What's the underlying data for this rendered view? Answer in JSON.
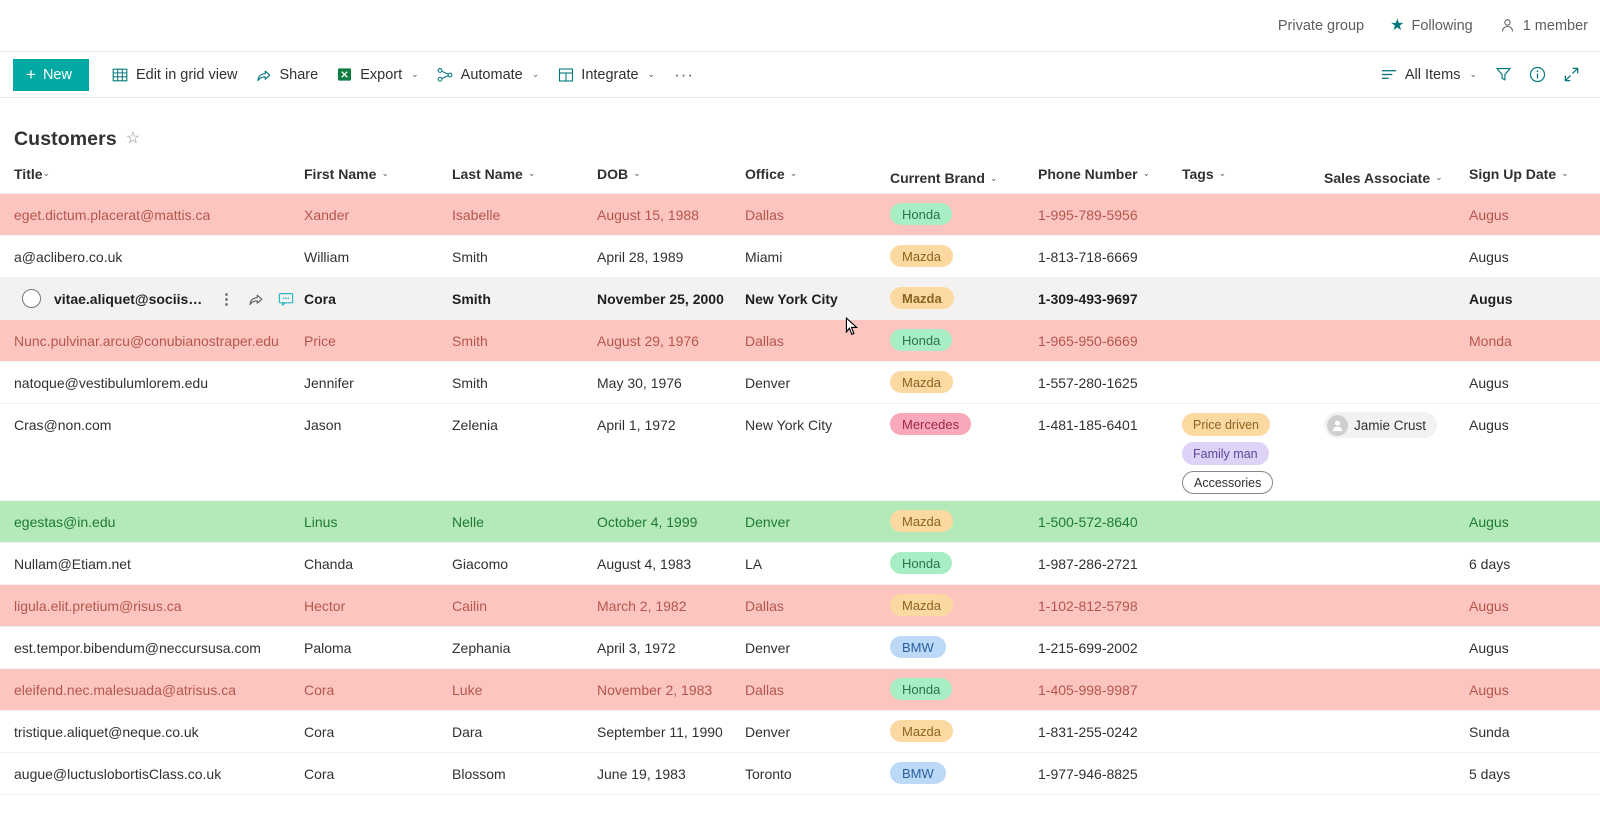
{
  "site_header": {
    "privacy_label": "Private group",
    "following_label": "Following",
    "members_label": "1 member",
    "star_glyph": "★"
  },
  "command_bar": {
    "new_label": "New",
    "new_plus": "+",
    "new_color": "#03a9a3",
    "items": [
      {
        "label": "Edit in grid view",
        "icon": "grid-icon",
        "has_chevron": false
      },
      {
        "label": "Share",
        "icon": "share-icon",
        "has_chevron": false
      },
      {
        "label": "Export",
        "icon": "excel-icon",
        "has_chevron": true
      },
      {
        "label": "Automate",
        "icon": "automate-icon",
        "has_chevron": true
      },
      {
        "label": "Integrate",
        "icon": "integrate-icon",
        "has_chevron": true
      }
    ],
    "overflow_label": "···",
    "view_label": "All Items",
    "chevron_glyph": "⌄"
  },
  "page": {
    "title": "Customers",
    "favorite_glyph": "☆"
  },
  "table": {
    "columns": [
      {
        "label": "Title",
        "key": "title"
      },
      {
        "label": "First Name",
        "key": "first"
      },
      {
        "label": "Last Name",
        "key": "last"
      },
      {
        "label": "DOB",
        "key": "dob"
      },
      {
        "label": "Office",
        "key": "office"
      },
      {
        "label": "Current Brand",
        "key": "brand"
      },
      {
        "label": "Phone Number",
        "key": "phone"
      },
      {
        "label": "Tags",
        "key": "tags"
      },
      {
        "label": "Sales Associate",
        "key": "assoc"
      },
      {
        "label": "Sign Up Date",
        "key": "sign"
      }
    ],
    "rows": [
      {
        "state": "red",
        "title": "eget.dictum.placerat@mattis.ca",
        "first": "Xander",
        "last": "Isabelle",
        "dob": "August 15, 1988",
        "office": "Dallas",
        "brand": "Honda",
        "phone": "1-995-789-5956",
        "tags": [],
        "assoc": "",
        "sign": "Augus"
      },
      {
        "state": "plain",
        "title": "a@aclibero.co.uk",
        "first": "William",
        "last": "Smith",
        "dob": "April 28, 1989",
        "office": "Miami",
        "brand": "Mazda",
        "phone": "1-813-718-6669",
        "tags": [],
        "assoc": "",
        "sign": "Augus"
      },
      {
        "state": "hovered",
        "title": "vitae.aliquet@sociisnatoq...",
        "first": "Cora",
        "last": "Smith",
        "dob": "November 25, 2000",
        "office": "New York City",
        "brand": "Mazda",
        "phone": "1-309-493-9697",
        "tags": [],
        "assoc": "",
        "sign": "Augus"
      },
      {
        "state": "red",
        "title": "Nunc.pulvinar.arcu@conubianostraper.edu",
        "first": "Price",
        "last": "Smith",
        "dob": "August 29, 1976",
        "office": "Dallas",
        "brand": "Honda",
        "phone": "1-965-950-6669",
        "tags": [],
        "assoc": "",
        "sign": "Monda"
      },
      {
        "state": "plain",
        "title": "natoque@vestibulumlorem.edu",
        "first": "Jennifer",
        "last": "Smith",
        "dob": "May 30, 1976",
        "office": "Denver",
        "brand": "Mazda",
        "phone": "1-557-280-1625",
        "tags": [],
        "assoc": "",
        "sign": "Augus"
      },
      {
        "state": "plain",
        "tall": true,
        "title": "Cras@non.com",
        "first": "Jason",
        "last": "Zelenia",
        "dob": "April 1, 1972",
        "office": "New York City",
        "brand": "Mercedes",
        "phone": "1-481-185-6401",
        "tags": [
          "Price driven",
          "Family man",
          "Accessories"
        ],
        "assoc": "Jamie Crust",
        "sign": "Augus"
      },
      {
        "state": "green",
        "title": "egestas@in.edu",
        "first": "Linus",
        "last": "Nelle",
        "dob": "October 4, 1999",
        "office": "Denver",
        "brand": "Mazda",
        "phone": "1-500-572-8640",
        "tags": [],
        "assoc": "",
        "sign": "Augus"
      },
      {
        "state": "plain",
        "title": "Nullam@Etiam.net",
        "first": "Chanda",
        "last": "Giacomo",
        "dob": "August 4, 1983",
        "office": "LA",
        "brand": "Honda",
        "phone": "1-987-286-2721",
        "tags": [],
        "assoc": "",
        "sign": "6 days"
      },
      {
        "state": "red",
        "title": "ligula.elit.pretium@risus.ca",
        "first": "Hector",
        "last": "Cailin",
        "dob": "March 2, 1982",
        "office": "Dallas",
        "brand": "Mazda",
        "phone": "1-102-812-5798",
        "tags": [],
        "assoc": "",
        "sign": "Augus"
      },
      {
        "state": "plain",
        "title": "est.tempor.bibendum@neccursusa.com",
        "first": "Paloma",
        "last": "Zephania",
        "dob": "April 3, 1972",
        "office": "Denver",
        "brand": "BMW",
        "phone": "1-215-699-2002",
        "tags": [],
        "assoc": "",
        "sign": "Augus"
      },
      {
        "state": "red",
        "title": "eleifend.nec.malesuada@atrisus.ca",
        "first": "Cora",
        "last": "Luke",
        "dob": "November 2, 1983",
        "office": "Dallas",
        "brand": "Honda",
        "phone": "1-405-998-9987",
        "tags": [],
        "assoc": "",
        "sign": "Augus"
      },
      {
        "state": "plain",
        "title": "tristique.aliquet@neque.co.uk",
        "first": "Cora",
        "last": "Dara",
        "dob": "September 11, 1990",
        "office": "Denver",
        "brand": "Mazda",
        "phone": "1-831-255-0242",
        "tags": [],
        "assoc": "",
        "sign": "Sunda"
      },
      {
        "state": "plain",
        "title": "augue@luctuslobortisClass.co.uk",
        "first": "Cora",
        "last": "Blossom",
        "dob": "June 19, 1983",
        "office": "Toronto",
        "brand": "BMW",
        "phone": "1-977-946-8825",
        "tags": [],
        "assoc": "",
        "sign": "5 days"
      }
    ]
  }
}
